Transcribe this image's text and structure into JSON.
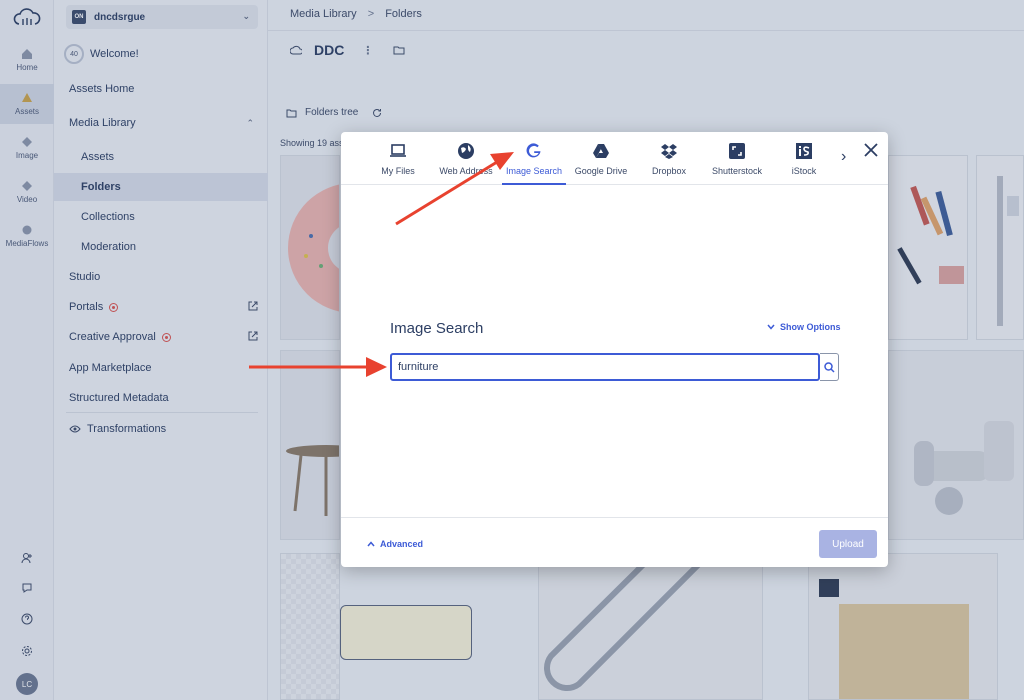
{
  "rail": {
    "items": [
      {
        "label": "Home",
        "icon": "home-icon"
      },
      {
        "label": "Assets",
        "icon": "assets-icon",
        "active": true
      },
      {
        "label": "Image",
        "icon": "image-icon"
      },
      {
        "label": "Video",
        "icon": "video-icon"
      },
      {
        "label": "MediaFlows",
        "icon": "mediaflows-icon"
      }
    ],
    "avatar_initials": "LC"
  },
  "sidenav": {
    "account_badge": "ON",
    "account_name": "dncdsrgue",
    "welcome_progress": "40",
    "welcome_label": "Welcome!",
    "items": [
      {
        "label": "Assets Home"
      },
      {
        "label": "Media Library"
      },
      {
        "label": "Assets"
      },
      {
        "label": "Folders"
      },
      {
        "label": "Collections"
      },
      {
        "label": "Moderation"
      },
      {
        "label": "Studio"
      },
      {
        "label": "Portals"
      },
      {
        "label": "Creative Approval"
      },
      {
        "label": "App Marketplace"
      },
      {
        "label": "Structured Metadata"
      },
      {
        "label": "Transformations"
      }
    ]
  },
  "main": {
    "breadcrumb": [
      "Media Library",
      "Folders"
    ],
    "breadcrumb_sep": ">",
    "folder_title": "DDC",
    "folder_more": "⋮",
    "folders_tree_label": "Folders tree",
    "showing_label": "Showing 19 ass"
  },
  "modal": {
    "tabs": [
      {
        "label": "My Files",
        "icon": "laptop-icon"
      },
      {
        "label": "Web Address",
        "icon": "globe-icon"
      },
      {
        "label": "Image Search",
        "icon": "google-icon",
        "active": true
      },
      {
        "label": "Google Drive",
        "icon": "google-drive-icon"
      },
      {
        "label": "Dropbox",
        "icon": "dropbox-icon"
      },
      {
        "label": "Shutterstock",
        "icon": "shutterstock-icon"
      },
      {
        "label": "iStock",
        "icon": "istock-icon"
      }
    ],
    "next_glyph": "›",
    "title": "Image Search",
    "show_options": "Show Options",
    "search_value": "furniture",
    "advanced": "Advanced",
    "upload": "Upload"
  },
  "colors": {
    "accent": "#3d5bd6",
    "annotation_arrow": "#e8422f"
  }
}
